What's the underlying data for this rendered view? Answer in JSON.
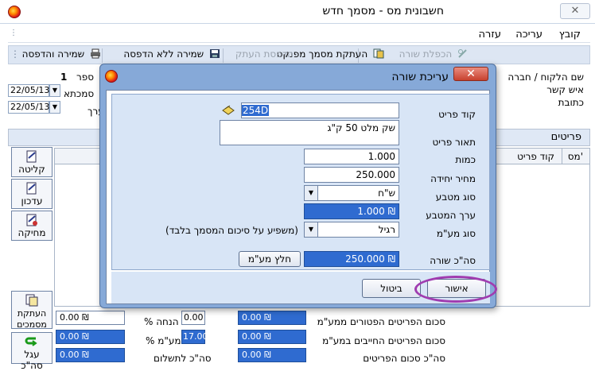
{
  "window": {
    "title": "חשבונית מס - מסמך חדש",
    "close": "✕"
  },
  "menu": [
    "קובץ",
    "עריכה",
    "עזרה"
  ],
  "toolbar": {
    "duplicate_row": "הכפלת שורה",
    "copy_from_document": "העתקת מסמך מפנקס",
    "print_copy": "הדפסת העתק",
    "save_no_print": "שמירה ללא הדפסה",
    "save_and_print": "שמירה והדפסה"
  },
  "header_fields": {
    "customer_name": "שם הלקוח / חברה",
    "contact": "איש קשר",
    "address": "כתובת",
    "number_label": "ספר",
    "number_value": "1",
    "reference_label": "סמכתא",
    "value_label": "ערך",
    "date1": "22/05/13",
    "date2": "22/05/13"
  },
  "tabs": {
    "items": "פריטים"
  },
  "grid": {
    "col_num": "מס'",
    "col_code": "קוד פריט"
  },
  "side_buttons": {
    "receive": "קליטה",
    "update": "עדכון",
    "delete": "מחיקה",
    "copy_docs": "העתקת מסמכים",
    "round_total": "עגל סה\"כ"
  },
  "totals": {
    "exempt_label": "סכום הפריטים הפטורים ממע\"מ",
    "exempt_value": "0.00 ₪",
    "taxable_label": "סכום הפריטים החייבים במע\"מ",
    "taxable_value": "0.00 ₪",
    "items_total_label": "סה\"כ סכום הפריטים",
    "items_total_value": "0.00 ₪",
    "discount_label": "% הנחה",
    "discount_value": "0.00",
    "vat_label": "% מע\"מ",
    "vat_value": "17.00",
    "to_pay_label": "סה\"כ לתשלום",
    "left_value_1": "0.00 ₪",
    "left_value_2": "0.00 ₪",
    "left_value_3": "0.00 ₪"
  },
  "dialog": {
    "title": "עריכת שורה",
    "close": "✕",
    "item_code_label": "קוד פריט",
    "item_code_value": "254D",
    "item_desc_label": "תאור פריט",
    "item_desc_value": "שק מלט 50 ק\"ג",
    "qty_label": "כמות",
    "qty_value": "1.000",
    "unit_price_label": "מחיר יחידה",
    "unit_price_value": "250.000",
    "currency_label": "סוג מטבע",
    "currency_value": "ש\"ח",
    "currency_rate_label": "ערך המטבע",
    "currency_rate_value": "1.000 ₪",
    "vat_type_label": "סוג מע\"מ",
    "vat_type_value": "רגיל",
    "vat_note": "(משפיע על סיכום המסמך בלבד)",
    "line_total_label": "סה\"כ שורה",
    "line_total_value": "250.000 ₪",
    "extract_vat_button": "חלץ מע\"מ",
    "ok_button": "אישור",
    "cancel_button": "ביטול"
  },
  "colors": {
    "accent_blue": "#2f6bd0",
    "dialog_frame": "#86a9d8",
    "close_red": "#c8412e",
    "highlight": "#a03cb0"
  }
}
